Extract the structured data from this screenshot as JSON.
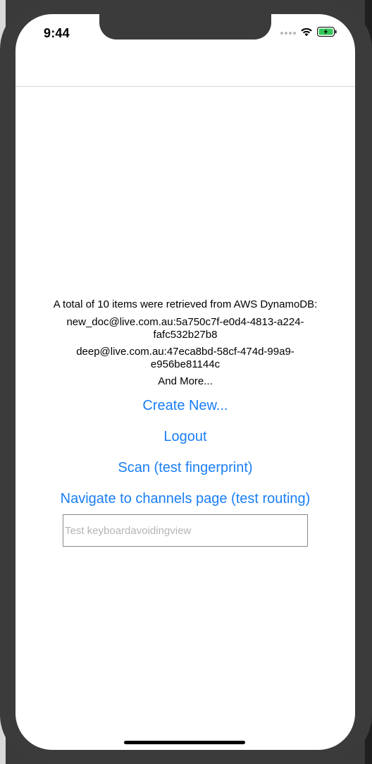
{
  "status_bar": {
    "time": "9:44",
    "icons": [
      "signal-dots-icon",
      "wifi-icon",
      "battery-charging-icon"
    ],
    "battery_color": "#34c759"
  },
  "main": {
    "summary": "A total of 10 items were retrieved from AWS DynamoDB:",
    "items": [
      {
        "line1": "new_doc@live.com.au:5a750c7f-e0d4-4813-a224-",
        "line2": "fafc532b27b8"
      },
      {
        "line1": "deep@live.com.au:47eca8bd-58cf-474d-99a9-",
        "line2": "e956be81144c"
      }
    ],
    "more": "And More...",
    "buttons": {
      "create": "Create New...",
      "logout": "Logout",
      "scan": "Scan (test fingerprint)",
      "navigate": "Navigate to channels page (test routing)"
    },
    "input": {
      "placeholder": "Test keyboardavoidingview",
      "value": ""
    }
  },
  "colors": {
    "link": "#1a7ef5",
    "background": "#ffffff",
    "device_frame": "#3b3b3b"
  }
}
